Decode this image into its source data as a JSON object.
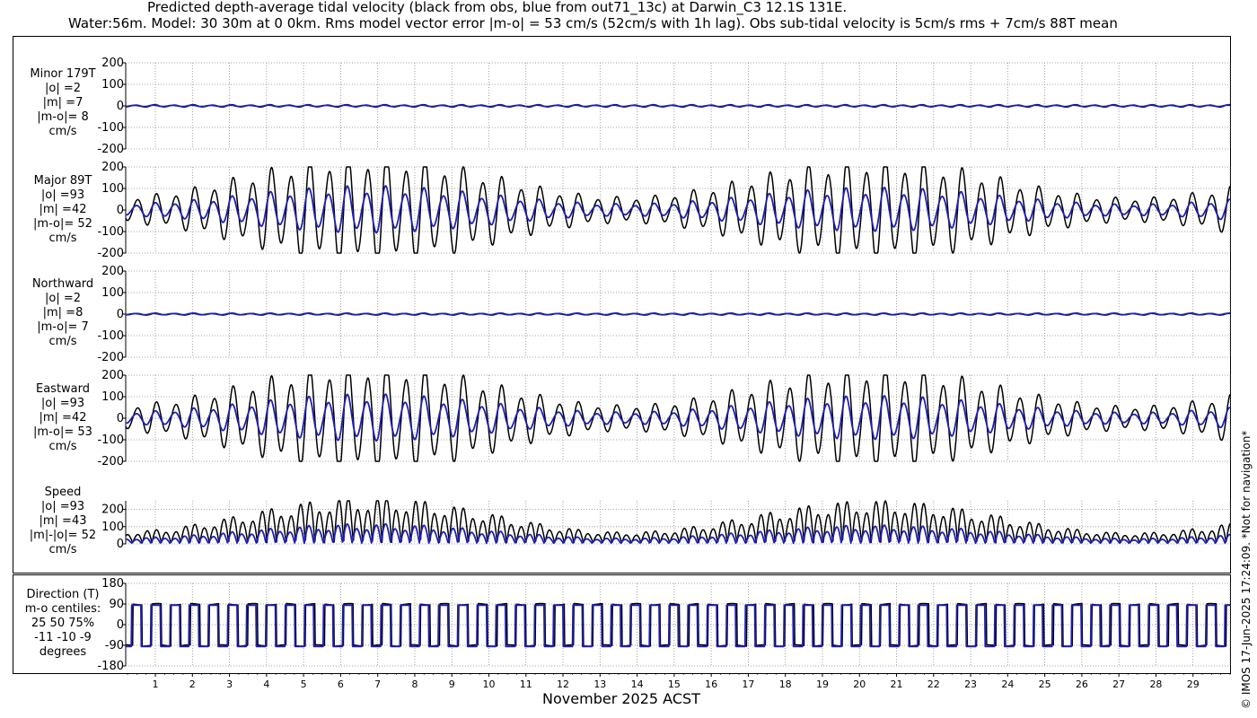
{
  "title": {
    "line1": "Predicted depth-average tidal velocity (black from obs, blue from out71_13c) at Darwin_C3 12.1S 131E.",
    "line2": "Water:56m. Model: 30 30m at 0 0km. Rms model vector error |m-o| = 53 cm/s (52cm/s with 1h lag). Obs sub-tidal velocity is 5cm/s rms + 7cm/s 88T mean"
  },
  "copyright": "© IMOS 17-Jun-2025 17:24:09. *Not for navigation*",
  "colors": {
    "obs": "#000000",
    "model": "#1f1fb4",
    "grid": "#888888"
  },
  "xaxis": {
    "label": "November 2025 ACST",
    "ticks": [
      "1",
      "2",
      "3",
      "4",
      "5",
      "6",
      "7",
      "8",
      "9",
      "10",
      "11",
      "12",
      "13",
      "14",
      "15",
      "16",
      "17",
      "18",
      "19",
      "20",
      "21",
      "22",
      "23",
      "24",
      "25",
      "26",
      "27",
      "28",
      "29"
    ],
    "range_days": [
      0.2,
      30.0
    ]
  },
  "chart_data": [
    {
      "type": "line",
      "panel": "minor",
      "labels": [
        "Minor 179T",
        "|o| =2",
        "|m| =7",
        "|m-o|= 8",
        "cm/s"
      ],
      "yticks": [
        "200",
        "100",
        "0",
        "-100",
        "-200"
      ],
      "ylim": [
        -200,
        200
      ],
      "series": [
        {
          "role": "obs",
          "semidiurnal_amplitude": 5,
          "phase": 0.6
        },
        {
          "role": "model",
          "semidiurnal_amplitude": 3,
          "phase": 1.0
        }
      ],
      "grid": true
    },
    {
      "type": "line",
      "panel": "major",
      "labels": [
        "Major 89T",
        "|o| =93",
        "|m| =42",
        "|m-o|= 52",
        "cm/s"
      ],
      "yticks": [
        "200",
        "100",
        "0",
        "-100",
        "-200"
      ],
      "ylim": [
        -200,
        200
      ],
      "series": [
        {
          "role": "obs",
          "max_amplitude": 225,
          "min_amplitude": 55
        },
        {
          "role": "model",
          "max_amplitude": 95,
          "min_amplitude": 25
        }
      ],
      "spring_days": [
        6.8,
        20.5
      ],
      "neap_days": [
        14.0,
        28.0
      ],
      "grid": true
    },
    {
      "type": "line",
      "panel": "northward",
      "labels": [
        "Northward",
        "|o| =2",
        "|m| =8",
        "|m-o|= 7",
        "cm/s"
      ],
      "yticks": [
        "200",
        "100",
        "0",
        "-100",
        "-200"
      ],
      "ylim": [
        -200,
        200
      ],
      "series": [
        {
          "role": "obs",
          "semidiurnal_amplitude": 4,
          "phase": 0.3
        },
        {
          "role": "model",
          "semidiurnal_amplitude": 3,
          "phase": 0.9
        }
      ],
      "grid": true
    },
    {
      "type": "line",
      "panel": "eastward",
      "labels": [
        "Eastward",
        "|o| =93",
        "|m| =42",
        "|m-o|= 53",
        "cm/s"
      ],
      "yticks": [
        "200",
        "100",
        "0",
        "-100",
        "-200"
      ],
      "ylim": [
        -200,
        200
      ],
      "series": [
        {
          "role": "obs",
          "max_amplitude": 225,
          "min_amplitude": 55
        },
        {
          "role": "model",
          "max_amplitude": 95,
          "min_amplitude": 25
        }
      ],
      "grid": true
    },
    {
      "type": "line",
      "panel": "speed",
      "labels": [
        "Speed",
        "|o| =93",
        "|m| =43",
        "|m|-|o|= 52",
        "cm/s"
      ],
      "yticks": [
        "200",
        "100",
        "0"
      ],
      "ylim": [
        0,
        250
      ],
      "series": [
        {
          "role": "obs",
          "max_amplitude": 225,
          "min_amplitude": 55
        },
        {
          "role": "model",
          "max_amplitude": 95,
          "min_amplitude": 25
        }
      ],
      "grid": true
    },
    {
      "type": "line",
      "panel": "direction",
      "labels": [
        "Direction (T)",
        "m-o centiles:",
        "25  50  75%",
        "-11 -10  -9",
        "degrees"
      ],
      "yticks": [
        "180",
        "90",
        "0",
        "-90",
        "-180"
      ],
      "ylim": [
        -180,
        180
      ],
      "series": [
        {
          "role": "obs",
          "flood_direction": 89,
          "ebb_direction": -91
        },
        {
          "role": "model",
          "flood_direction": 85,
          "ebb_direction": -95
        }
      ],
      "grid": true
    }
  ]
}
